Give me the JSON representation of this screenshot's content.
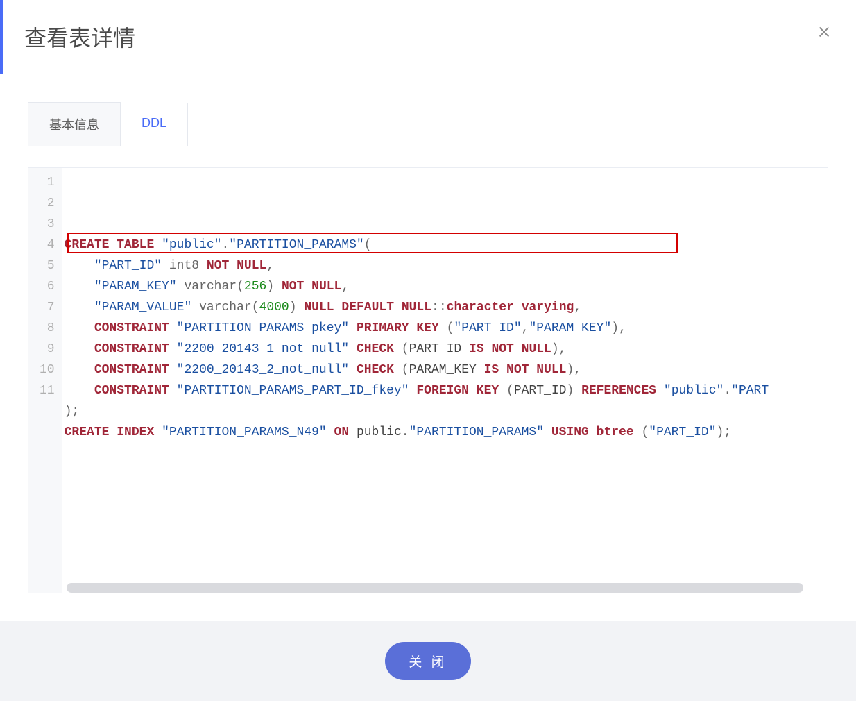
{
  "header": {
    "title": "查看表详情"
  },
  "tabs": [
    {
      "label": "基本信息",
      "active": false
    },
    {
      "label": "DDL",
      "active": true
    }
  ],
  "editor": {
    "line_count": 11,
    "highlighted_line": 4,
    "lines_html": [
      "<span class='kw'>CREATE</span> <span class='kw'>TABLE</span> <span class='str'>\"public\"</span><span class='pn'>.</span><span class='str'>\"PARTITION_PARAMS\"</span><span class='pn'>(</span>",
      "    <span class='str'>\"PART_ID\"</span> <span class='fn'>int8</span> <span class='kw'>NOT</span> <span class='kw'>NULL</span><span class='pn'>,</span>",
      "    <span class='str'>\"PARAM_KEY\"</span> <span class='fn'>varchar</span><span class='pn'>(</span><span class='num'>256</span><span class='pn'>)</span> <span class='kw'>NOT</span> <span class='kw'>NULL</span><span class='pn'>,</span>",
      "    <span class='str'>\"PARAM_VALUE\"</span> <span class='fn'>varchar</span><span class='pn'>(</span><span class='num'>4000</span><span class='pn'>)</span> <span class='kw'>NULL</span> <span class='kw'>DEFAULT</span> <span class='kw'>NULL</span><span class='pn'>::</span><span class='ty'>character</span> <span class='ty'>varying</span><span class='pn'>,</span>",
      "    <span class='kw'>CONSTRAINT</span> <span class='str'>\"PARTITION_PARAMS_pkey\"</span> <span class='kw'>PRIMARY</span> <span class='kw'>KEY</span> <span class='pn'>(</span><span class='str'>\"PART_ID\"</span><span class='pn'>,</span><span class='str'>\"PARAM_KEY\"</span><span class='pn'>),</span>",
      "    <span class='kw'>CONSTRAINT</span> <span class='str'>\"2200_20143_1_not_null\"</span> <span class='kw'>CHECK</span> <span class='pn'>(</span><span class='id'>PART_ID</span> <span class='kw'>IS</span> <span class='kw'>NOT</span> <span class='kw'>NULL</span><span class='pn'>),</span>",
      "    <span class='kw'>CONSTRAINT</span> <span class='str'>\"2200_20143_2_not_null\"</span> <span class='kw'>CHECK</span> <span class='pn'>(</span><span class='id'>PARAM_KEY</span> <span class='kw'>IS</span> <span class='kw'>NOT</span> <span class='kw'>NULL</span><span class='pn'>),</span>",
      "    <span class='kw'>CONSTRAINT</span> <span class='str'>\"PARTITION_PARAMS_PART_ID_fkey\"</span> <span class='kw'>FOREIGN</span> <span class='kw'>KEY</span> <span class='pn'>(</span><span class='id'>PART_ID</span><span class='pn'>)</span> <span class='kw'>REFERENCES</span> <span class='str'>\"public\"</span><span class='pn'>.</span><span class='str'>\"PART</span>",
      "<span class='pn'>);</span>",
      "<span class='kw'>CREATE</span> <span class='kw'>INDEX</span> <span class='str'>\"PARTITION_PARAMS_N49\"</span> <span class='kw'>ON</span> <span class='id'>public</span><span class='pn'>.</span><span class='str'>\"PARTITION_PARAMS\"</span> <span class='kw'>USING</span> <span class='kw'>btree</span> <span class='pn'>(</span><span class='str'>\"PART_ID\"</span><span class='pn'>);</span>",
      "<span class='cursor'></span>"
    ]
  },
  "footer": {
    "close_label": "关 闭"
  }
}
